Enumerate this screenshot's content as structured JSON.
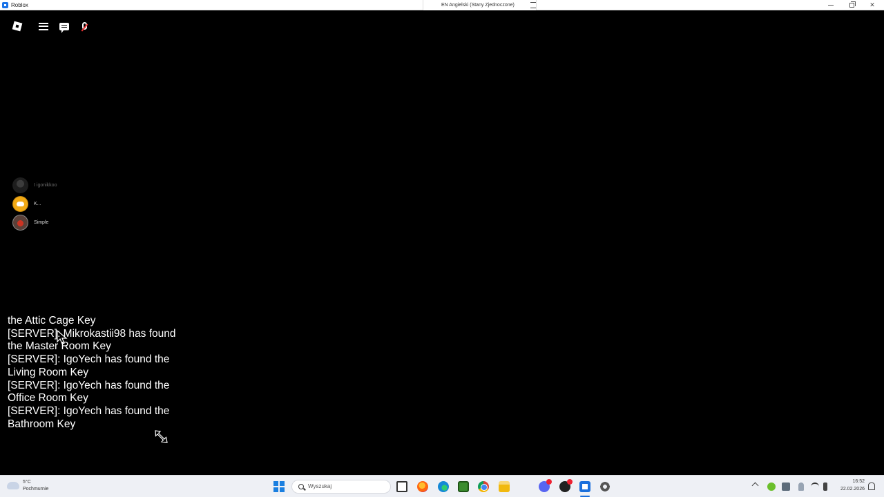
{
  "window": {
    "title": "Roblox",
    "language_indicator": "EN Angielski (Stany Zjednoczone)"
  },
  "topbar": {
    "icons": [
      "roblox-logo-icon",
      "hamburger-menu-icon",
      "chat-icon",
      "microphone-muted-icon"
    ],
    "mic_muted_color": "#e33333"
  },
  "voice_users": [
    {
      "name": "I igonikkoo",
      "speaking": false
    },
    {
      "name": "K...",
      "speaking": true
    },
    {
      "name": "Simple",
      "speaking": true
    }
  ],
  "chat": {
    "lines": [
      "the Attic Cage Key",
      "[SERVER]: Mikrokastii98 has found",
      "the Master Room Key",
      "[SERVER]: IgoYech has found the",
      "Living Room Key",
      "[SERVER]: IgoYech has found the",
      "Office Room Key",
      "[SERVER]: IgoYech has found the",
      "Bathroom Key"
    ]
  },
  "taskbar": {
    "weather": {
      "temp": "5°C",
      "desc": "Pochmurnie"
    },
    "search_placeholder": "Wyszukaj",
    "pinned": [
      "task-view-icon",
      "firefox-icon",
      "edge-icon",
      "minecraft-icon",
      "chrome-icon",
      "file-explorer-icon",
      "discord-icon",
      "app-icon",
      "roblox-icon",
      "settings-icon"
    ],
    "active_app": "roblox-icon",
    "accent": "#1a73e8"
  },
  "tray": {
    "time": "16:52",
    "date": "22.02.2026"
  }
}
